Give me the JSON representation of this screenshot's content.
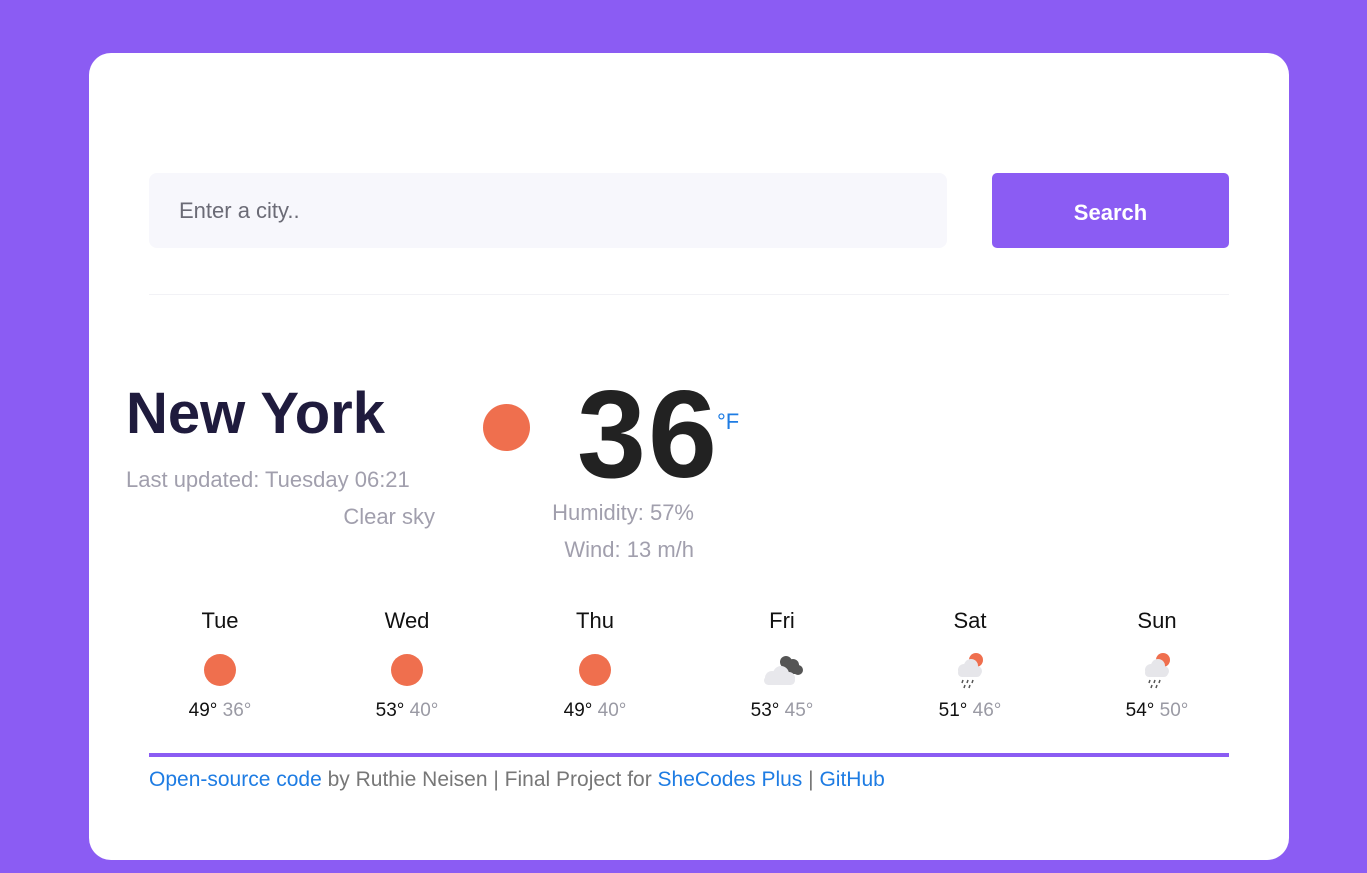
{
  "search": {
    "placeholder": "Enter a city..",
    "button_label": "Search"
  },
  "current": {
    "city": "New York",
    "last_updated": "Last updated: Tuesday 06:21",
    "condition": "Clear sky",
    "icon": "clear-sky-icon",
    "temperature": "36",
    "unit": "°F",
    "humidity": "Humidity: 57%",
    "wind": "Wind: 13 m/h"
  },
  "forecast": [
    {
      "day": "Tue",
      "max": "49°",
      "min": "36°",
      "icon": "clear-sky-icon"
    },
    {
      "day": "Wed",
      "max": "53°",
      "min": "40°",
      "icon": "clear-sky-icon"
    },
    {
      "day": "Thu",
      "max": "49°",
      "min": "40°",
      "icon": "clear-sky-icon"
    },
    {
      "day": "Fri",
      "max": "53°",
      "min": "45°",
      "icon": "broken-clouds-icon"
    },
    {
      "day": "Sat",
      "max": "51°",
      "min": "46°",
      "icon": "rain-icon"
    },
    {
      "day": "Sun",
      "max": "54°",
      "min": "50°",
      "icon": "rain-icon"
    }
  ],
  "footer": {
    "code_link": "Open-source code",
    "by_text": " by Ruthie Neisen | Final Project for ",
    "shecodes_link": "SheCodes Plus",
    "separator": " | ",
    "github_link": "GitHub"
  },
  "colors": {
    "accent": "#8b5cf3",
    "sun": "#ef6f4e",
    "link": "#1e7ce3",
    "muted": "#a19fad"
  }
}
